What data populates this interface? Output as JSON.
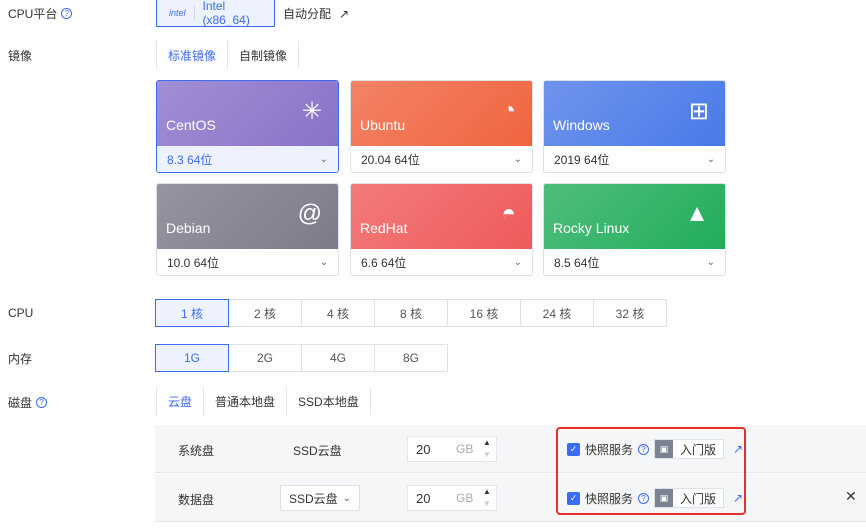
{
  "cpu_platform": {
    "label": "CPU平台",
    "option": "Intel (x86_64)",
    "auto": "自动分配"
  },
  "image": {
    "label": "镜像",
    "tabs": [
      "标准镜像",
      "自制镜像"
    ],
    "cards": [
      {
        "name": "CentOS",
        "version": "8.3 64位",
        "selected": true,
        "color": "#8a72c9"
      },
      {
        "name": "Ubuntu",
        "version": "20.04 64位",
        "color": "#f0643f"
      },
      {
        "name": "Windows",
        "version": "2019 64位",
        "color": "#4a79e8"
      },
      {
        "name": "Debian",
        "version": "10.0 64位",
        "color": "#7d7a8a"
      },
      {
        "name": "RedHat",
        "version": "6.6 64位",
        "color": "#ef5a5a"
      },
      {
        "name": "Rocky Linux",
        "version": "8.5 64位",
        "color": "#22ad5c"
      }
    ]
  },
  "cpu": {
    "label": "CPU",
    "options": [
      "1 核",
      "2 核",
      "4 核",
      "8 核",
      "16 核",
      "24 核",
      "32 核"
    ],
    "selected": 0
  },
  "memory": {
    "label": "内存",
    "options": [
      "1G",
      "2G",
      "4G",
      "8G"
    ],
    "selected": 0
  },
  "disk": {
    "label": "磁盘",
    "tabs": [
      "云盘",
      "普通本地盘",
      "SSD本地盘"
    ],
    "rows": [
      {
        "type": "系统盘",
        "disk": "SSD云盘",
        "size": "20",
        "unit": "GB",
        "snapshot": "快照服务",
        "edition": "入门版"
      },
      {
        "type": "数据盘",
        "disk": "SSD云盘",
        "size": "20",
        "unit": "GB",
        "snapshot": "快照服务",
        "edition": "入门版"
      }
    ]
  },
  "accent": "#3b6cf6"
}
